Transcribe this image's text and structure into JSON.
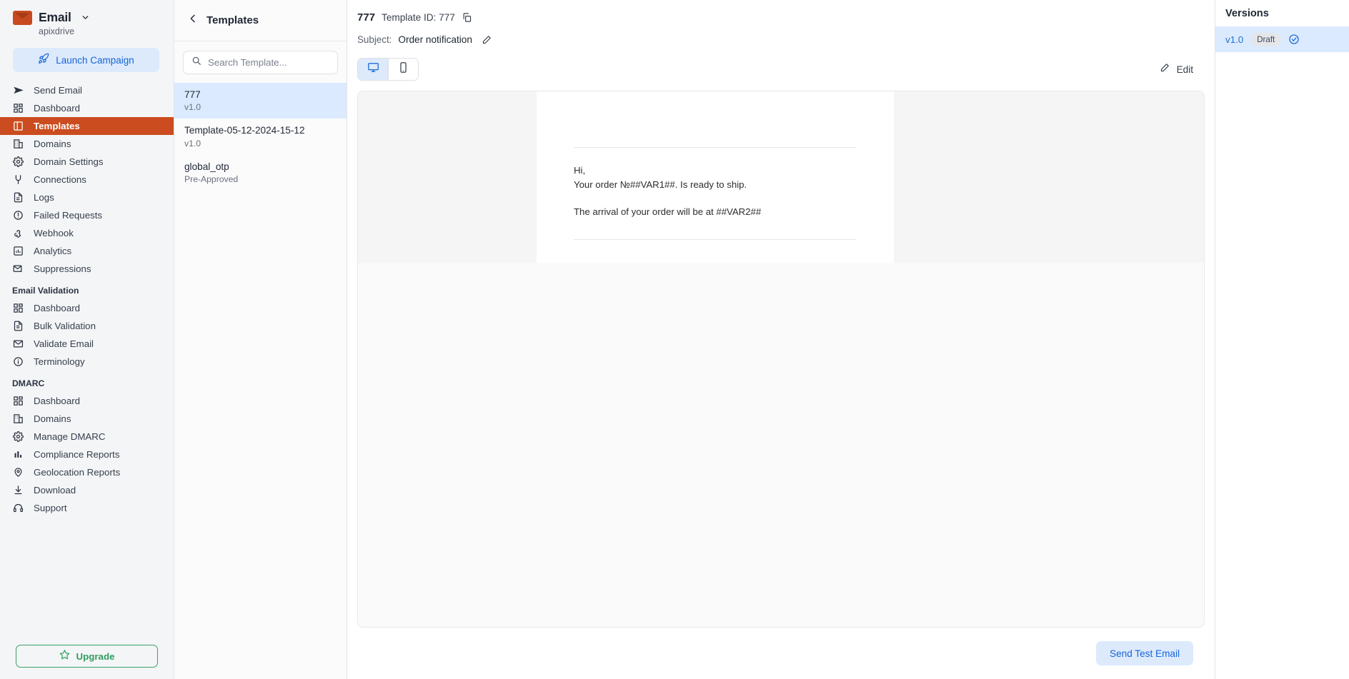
{
  "sidebar": {
    "brand": {
      "name": "Email",
      "account": "apixdrive",
      "logo_icon": "envelope-logo-icon",
      "caret_icon": "chevron-down-icon"
    },
    "launch": {
      "label": "Launch Campaign",
      "icon": "rocket-icon"
    },
    "primary_items": [
      {
        "label": "Send Email",
        "icon": "send-icon",
        "active": false
      },
      {
        "label": "Dashboard",
        "icon": "dashboard-grid-icon",
        "active": false
      },
      {
        "label": "Templates",
        "icon": "templates-panel-icon",
        "active": true
      },
      {
        "label": "Domains",
        "icon": "building-icon",
        "active": false
      },
      {
        "label": "Domain Settings",
        "icon": "gear-icon",
        "active": false
      },
      {
        "label": "Connections",
        "icon": "plug-icon",
        "active": false
      },
      {
        "label": "Logs",
        "icon": "document-icon",
        "active": false
      },
      {
        "label": "Failed Requests",
        "icon": "alert-circle-icon",
        "active": false
      },
      {
        "label": "Webhook",
        "icon": "webhook-icon",
        "active": false
      },
      {
        "label": "Analytics",
        "icon": "bar-chart-box-icon",
        "active": false
      },
      {
        "label": "Suppressions",
        "icon": "envelope-minus-icon",
        "active": false
      }
    ],
    "group_email_validation": {
      "title": "Email Validation",
      "items": [
        {
          "label": "Dashboard",
          "icon": "dashboard-grid-icon"
        },
        {
          "label": "Bulk Validation",
          "icon": "document-lines-icon"
        },
        {
          "label": "Validate Email",
          "icon": "envelope-icon"
        },
        {
          "label": "Terminology",
          "icon": "info-circle-icon"
        }
      ]
    },
    "group_dmarc": {
      "title": "DMARC",
      "items": [
        {
          "label": "Dashboard",
          "icon": "dashboard-grid-icon"
        },
        {
          "label": "Domains",
          "icon": "building-icon"
        },
        {
          "label": "Manage DMARC",
          "icon": "gear-icon"
        },
        {
          "label": "Compliance Reports",
          "icon": "bar-chart-icon"
        },
        {
          "label": "Geolocation Reports",
          "icon": "map-pin-icon"
        },
        {
          "label": "Download",
          "icon": "download-icon"
        },
        {
          "label": "Support",
          "icon": "headset-icon"
        }
      ]
    },
    "upgrade": {
      "label": "Upgrade",
      "icon": "star-icon"
    },
    "colors": {
      "active_bg": "#cb4c1f",
      "accent_blue": "#1565d8",
      "upgrade_green": "#2f9e61"
    }
  },
  "templates_panel": {
    "back_icon": "chevron-left-icon",
    "title": "Templates",
    "refresh_icon": "refresh-icon",
    "search": {
      "placeholder": "Search Template...",
      "value": "",
      "icon": "search-icon"
    },
    "items": [
      {
        "name": "777",
        "sub": "v1.0",
        "selected": true
      },
      {
        "name": "Template-05-12-2024-15-12",
        "sub": "v1.0",
        "selected": false
      },
      {
        "name": "global_otp",
        "sub": "Pre-Approved",
        "selected": false
      }
    ]
  },
  "main": {
    "template_name": "777",
    "template_id_label": "Template ID: 777",
    "copy_icon": "copy-icon",
    "subject_label": "Subject:",
    "subject_value": "Order notification",
    "subject_edit_icon": "pencil-icon",
    "device_toggle": [
      {
        "name": "desktop",
        "icon": "monitor-icon",
        "active": true
      },
      {
        "name": "mobile",
        "icon": "phone-icon",
        "active": false
      }
    ],
    "edit_button": {
      "label": "Edit",
      "icon": "pencil-icon"
    },
    "preview": {
      "line1": "Hi,",
      "line2": "Your order №##VAR1##. Is ready to ship.",
      "line3": "The arrival of your order will be at ##VAR2##"
    },
    "send_test_button": "Send Test Email"
  },
  "versions": {
    "title": "Versions",
    "items": [
      {
        "version": "v1.0",
        "badge": "Draft",
        "check_icon": "check-circle-icon",
        "selected": true
      }
    ]
  }
}
